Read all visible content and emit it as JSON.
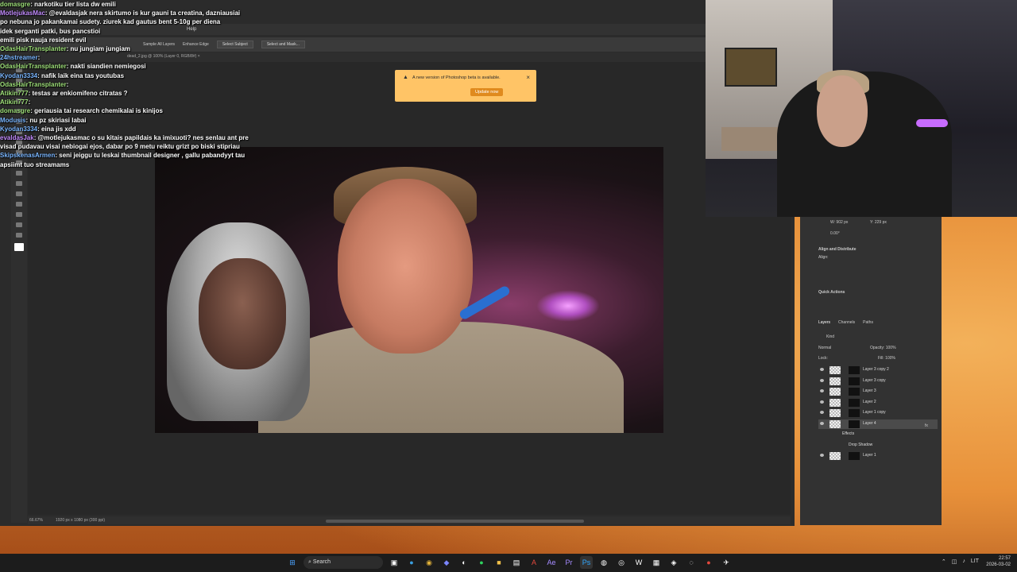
{
  "chat": [
    {
      "user": "domasgre",
      "msg": "narkotiku tier lista dw emili",
      "color": "green"
    },
    {
      "user": "MotlejukasMac",
      "msg": "@evaldasjak nera skirtumo is kur gauni ta creatina, dazniausiai",
      "color": "purple"
    },
    {
      "user": "",
      "msg": "po nebuna jo pakankamai sudety. ziurek kad gautus bent 5-10g per diena",
      "color": ""
    },
    {
      "user": "",
      "msg": "idek serganti patki, bus pancstioi",
      "color": ""
    },
    {
      "user": "",
      "msg": "emili pisk nauja resident evil",
      "color": ""
    },
    {
      "user": "OdasHairTransplanter",
      "msg": "nu jungiam jungiam",
      "color": "green"
    },
    {
      "user": "24hstreamer",
      "msg": "",
      "color": "blue"
    },
    {
      "user": "OdasHairTransplanter",
      "msg": "nakti siandien nemiegosi",
      "color": "green"
    },
    {
      "user": "Kyodan3334",
      "msg": "nafik laik eina tas youtubas",
      "color": "blue"
    },
    {
      "user": "OdasHairTransplanter",
      "msg": "",
      "color": "green"
    },
    {
      "user": "Atikin777",
      "msg": "testas ar enkiomifeno citratas ?",
      "color": "green"
    },
    {
      "user": "Atikin777",
      "msg": "",
      "color": "green"
    },
    {
      "user": "domasgre",
      "msg": "geriausia tai research chemikalai is kinijos",
      "color": "green"
    },
    {
      "user": "Modusis",
      "msg": "nu pz skiriasi labai",
      "color": "blue"
    },
    {
      "user": "Kyodan3334",
      "msg": "eina jis xdd",
      "color": "blue"
    },
    {
      "user": "evaldasJak",
      "msg": "@motlejukasmac o su kitais papildais ka imixuoti? nes senlau ant pre",
      "color": "purple"
    },
    {
      "user": "",
      "msg": "visad pudavau visai nebiogai ejos, dabar po 9 metu reiktu grizt po biski stipriau",
      "color": ""
    },
    {
      "user": "SkipskenasArmen",
      "msg": "seni jeiggu tu leskai thumbnail designer , gallu pabandyyt tau",
      "color": "blue"
    },
    {
      "user": "",
      "msg": "apsiimt tuo streamams",
      "color": ""
    }
  ],
  "photoshop": {
    "menu": [
      "Help"
    ],
    "options": [
      "Sample All Layers",
      "Enhance Edge",
      "Select Subject",
      "Select and Mask..."
    ],
    "doc_tab": "dead_2.jpg @ 100% (Layer 0, RGB/8#) ×",
    "status_zoom": "66.67%",
    "status_size": "1920 px x 1080 px (300 ppi)",
    "notification": {
      "text": "A new version of Photoshop beta is available.",
      "button": "Update now",
      "close": "×",
      "warn": "▲"
    },
    "panels": {
      "align": "Align and Distribute",
      "align_sub": "Align:",
      "quick": "Quick Actions",
      "tabs": [
        "Layers",
        "Channels",
        "Paths"
      ],
      "kind": "Kind",
      "blend": "Normal",
      "opacity": "Opacity: 100%",
      "fill": "Fill: 100%",
      "lock": "Lock:",
      "w": "W: 902 px",
      "h": "Y: 229 px",
      "angle": "0.00°"
    },
    "layers": [
      {
        "name": "Layer 3 copy 2",
        "selected": false
      },
      {
        "name": "Layer 3 copy",
        "selected": false
      },
      {
        "name": "Layer 3",
        "selected": false
      },
      {
        "name": "Layer 2",
        "selected": false
      },
      {
        "name": "Layer 1 copy",
        "selected": false
      },
      {
        "name": "Layer 4",
        "selected": true
      },
      {
        "name": "Effects",
        "selected": false
      },
      {
        "name": "Drop Shadow",
        "selected": false
      },
      {
        "name": "Layer 1",
        "selected": false
      }
    ],
    "fx": "fx"
  },
  "taskbar": {
    "search": "Search",
    "lang": "LIT",
    "time": "22:57",
    "date": "2026-03-02"
  }
}
